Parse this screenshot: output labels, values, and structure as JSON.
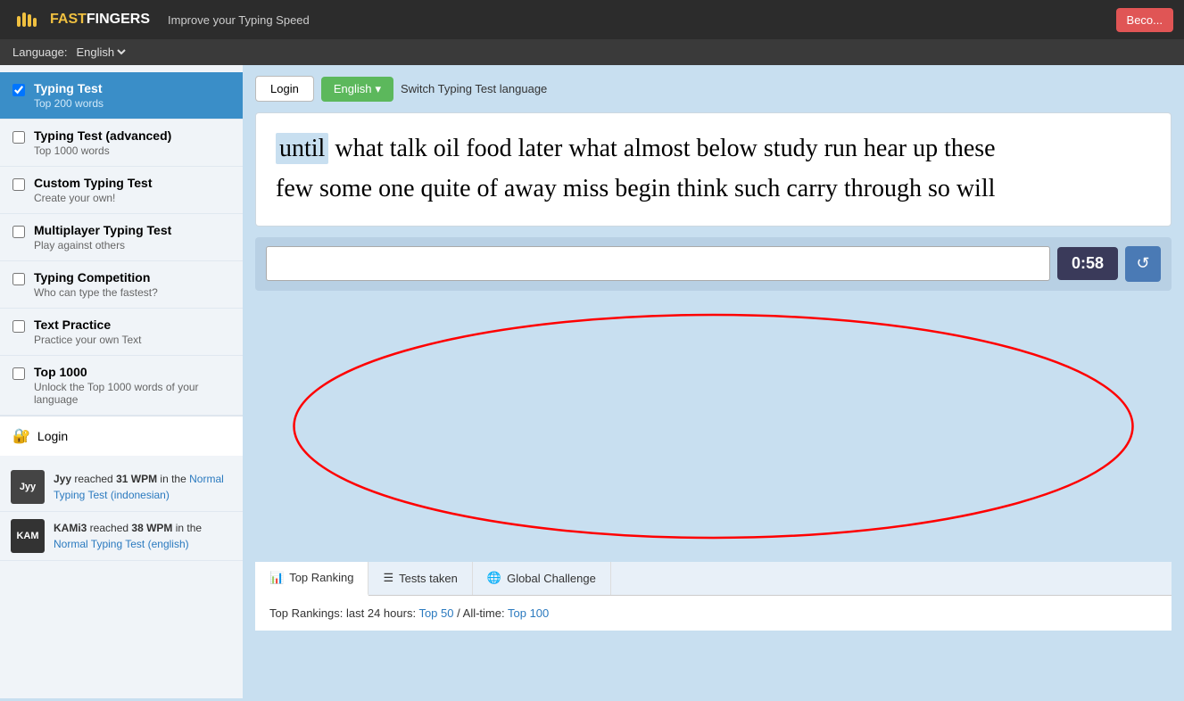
{
  "topbar": {
    "logo_fast": "FAST",
    "logo_fingers": "FINGERS",
    "tagline": "Improve your Typing Speed",
    "become_label": "Beco..."
  },
  "langbar": {
    "label": "Language:",
    "selected": "English"
  },
  "sidebar": {
    "items": [
      {
        "id": "typing-test",
        "title": "Typing Test",
        "subtitle": "Top 200 words",
        "active": true
      },
      {
        "id": "typing-test-advanced",
        "title": "Typing Test (advanced)",
        "subtitle": "Top 1000 words",
        "active": false
      },
      {
        "id": "custom-typing-test",
        "title": "Custom Typing Test",
        "subtitle": "Create your own!",
        "active": false
      },
      {
        "id": "multiplayer-typing-test",
        "title": "Multiplayer Typing Test",
        "subtitle": "Play against others",
        "active": false
      },
      {
        "id": "typing-competition",
        "title": "Typing Competition",
        "subtitle": "Who can type the fastest?",
        "active": false
      },
      {
        "id": "text-practice",
        "title": "Text Practice",
        "subtitle": "Practice your own Text",
        "active": false
      },
      {
        "id": "top-1000",
        "title": "Top 1000",
        "subtitle": "Unlock the Top 1000 words of your language",
        "active": false
      }
    ],
    "login_label": "Login"
  },
  "feed": {
    "items": [
      {
        "user": "Jyy",
        "wpm": "31 WPM",
        "text_pre": "reached",
        "text_mid": "in the",
        "link_text": "Normal Typing Test (indonesian)",
        "avatar_label": "Jyy"
      },
      {
        "user": "KAMi3",
        "wpm": "38 WPM",
        "text_pre": "reached",
        "text_mid": "in the",
        "link_text": "Normal Typing Test (english)",
        "avatar_label": "KAM"
      }
    ]
  },
  "content": {
    "login_btn": "Login",
    "language_btn": "English",
    "switch_lang_text": "Switch Typing Test language",
    "words_line1": "until what talk oil food later what almost below study run hear up these",
    "words_line2": "few some one quite of away miss begin think such carry through so will",
    "first_word": "until",
    "timer": "0:58",
    "reset_icon": "↺",
    "typing_placeholder": ""
  },
  "tabs": {
    "items": [
      {
        "id": "top-ranking",
        "icon": "📊",
        "label": "Top Ranking",
        "active": true
      },
      {
        "id": "tests-taken",
        "icon": "☰",
        "label": "Tests taken",
        "active": false
      },
      {
        "id": "global-challenge",
        "icon": "🌐",
        "label": "Global Challenge",
        "active": false
      }
    ],
    "rankings": {
      "label": "Top Rankings:",
      "time_label": "last 24 hours:",
      "top50_label": "Top 50",
      "separator": "/",
      "alltime_label": "All-time:",
      "top100_label": "Top 100"
    }
  }
}
